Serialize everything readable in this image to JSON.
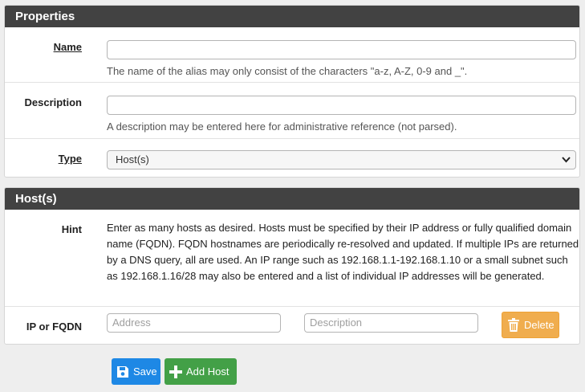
{
  "properties": {
    "heading": "Properties",
    "name_label": "Name",
    "name_value": "",
    "name_help": "The name of the alias may only consist of the characters \"a-z, A-Z, 0-9 and _\".",
    "description_label": "Description",
    "description_value": "",
    "description_help": "A description may be entered here for administrative reference (not parsed).",
    "type_label": "Type",
    "type_value": "Host(s)"
  },
  "hosts": {
    "heading": "Host(s)",
    "hint_label": "Hint",
    "hint_text": "Enter as many hosts as desired. Hosts must be specified by their IP address or fully qualified domain name (FQDN). FQDN hostnames are periodically re-resolved and updated. If multiple IPs are returned by a DNS query, all are used. An IP range such as 192.168.1.1-192.168.1.10 or a small subnet such as 192.168.1.16/28 may also be entered and a list of individual IP addresses will be generated.",
    "ip_label": "IP or FQDN",
    "address_placeholder": "Address",
    "desc_placeholder": "Description",
    "delete_label": "Delete"
  },
  "actions": {
    "save_label": "Save",
    "add_host_label": "Add Host"
  },
  "colors": {
    "heading_bg": "#424242",
    "save": "#1e88e5",
    "add": "#43a047",
    "delete": "#f0ad4e"
  },
  "icons": {
    "save": "floppy-disk-icon",
    "add": "plus-icon",
    "delete": "trash-icon",
    "select": "chevron-down-icon"
  }
}
